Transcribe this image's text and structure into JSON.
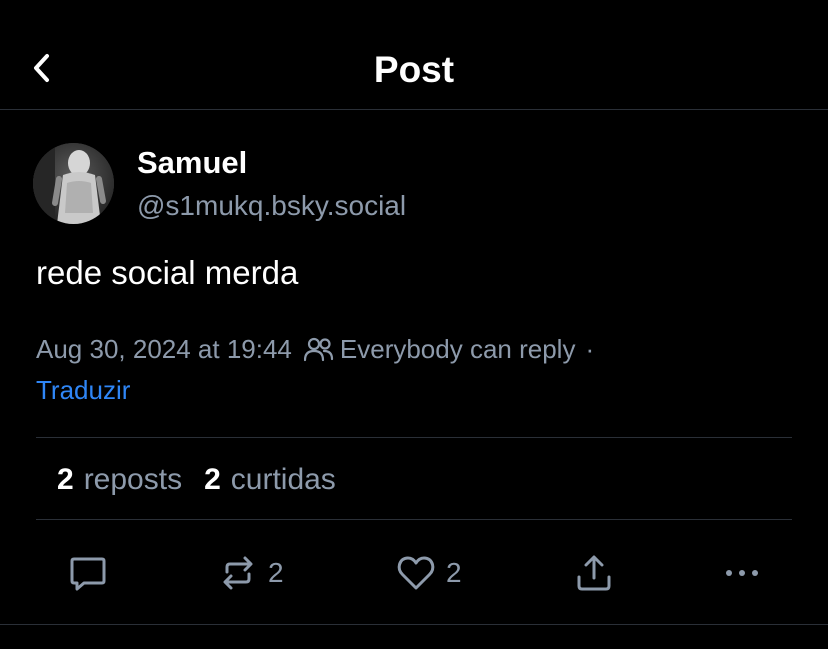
{
  "header": {
    "title": "Post",
    "back_icon": "chevron-left-icon"
  },
  "author": {
    "name": "Samuel",
    "handle": "@s1mukq.bsky.social"
  },
  "post": {
    "text": "rede social merda",
    "timestamp": "Aug 30, 2024 at 19:44",
    "reply_setting": "Everybody can reply",
    "separator": "·",
    "translate_label": "Traduzir"
  },
  "stats": {
    "reposts_count": "2",
    "reposts_label": "reposts",
    "likes_count": "2",
    "likes_label": "curtidas"
  },
  "actions": {
    "reply_icon": "comment-icon",
    "repost_icon": "repost-icon",
    "repost_count": "2",
    "like_icon": "heart-icon",
    "like_count": "2",
    "share_icon": "share-icon",
    "more_icon": "more-dots-icon"
  },
  "colors": {
    "background": "#000000",
    "text_primary": "#ffffff",
    "text_secondary": "#8d9aab",
    "link": "#2f86f6",
    "divider": "#2a2f37"
  }
}
